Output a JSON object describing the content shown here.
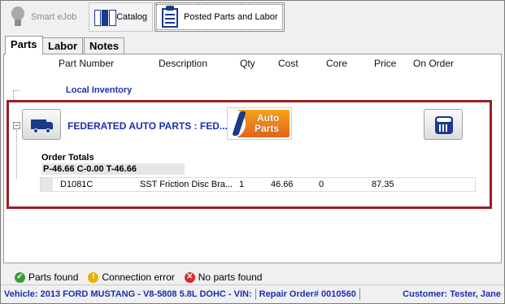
{
  "toolbar": {
    "smart_ejob": "Smart eJob",
    "catalog": "Catalog",
    "posted": "Posted Parts and Labor"
  },
  "tabs": {
    "parts": "Parts",
    "labor": "Labor",
    "notes": "Notes"
  },
  "columns": [
    "Part Number",
    "Description",
    "Qty",
    "Cost",
    "Core",
    "Price",
    "On Order"
  ],
  "group": "Local Inventory",
  "vendor": {
    "name": "FEDERATED AUTO PARTS : FED...",
    "logo_line1": "Auto",
    "logo_line2": "Parts"
  },
  "totals": {
    "label": "Order Totals",
    "value": "P-46.66 C-0.00 T-46.66"
  },
  "rows": [
    {
      "part": "D1081C",
      "desc": "SST Friction Disc Bra...",
      "qty": "1",
      "cost": "46.66",
      "core": "0",
      "price": "87.35",
      "on_order": ""
    }
  ],
  "legend": {
    "found": "Parts found",
    "conn": "Connection error",
    "none": "No parts found"
  },
  "status": {
    "vehicle": "Vehicle: 2013 FORD MUSTANG - V8-5808 5.8L DOHC - VIN:",
    "repair": "Repair Order# 0010560",
    "customer": "Customer: Tester, Jane"
  },
  "colors": {
    "accent": "#1a2fb0",
    "highlight": "#9b1d24"
  }
}
